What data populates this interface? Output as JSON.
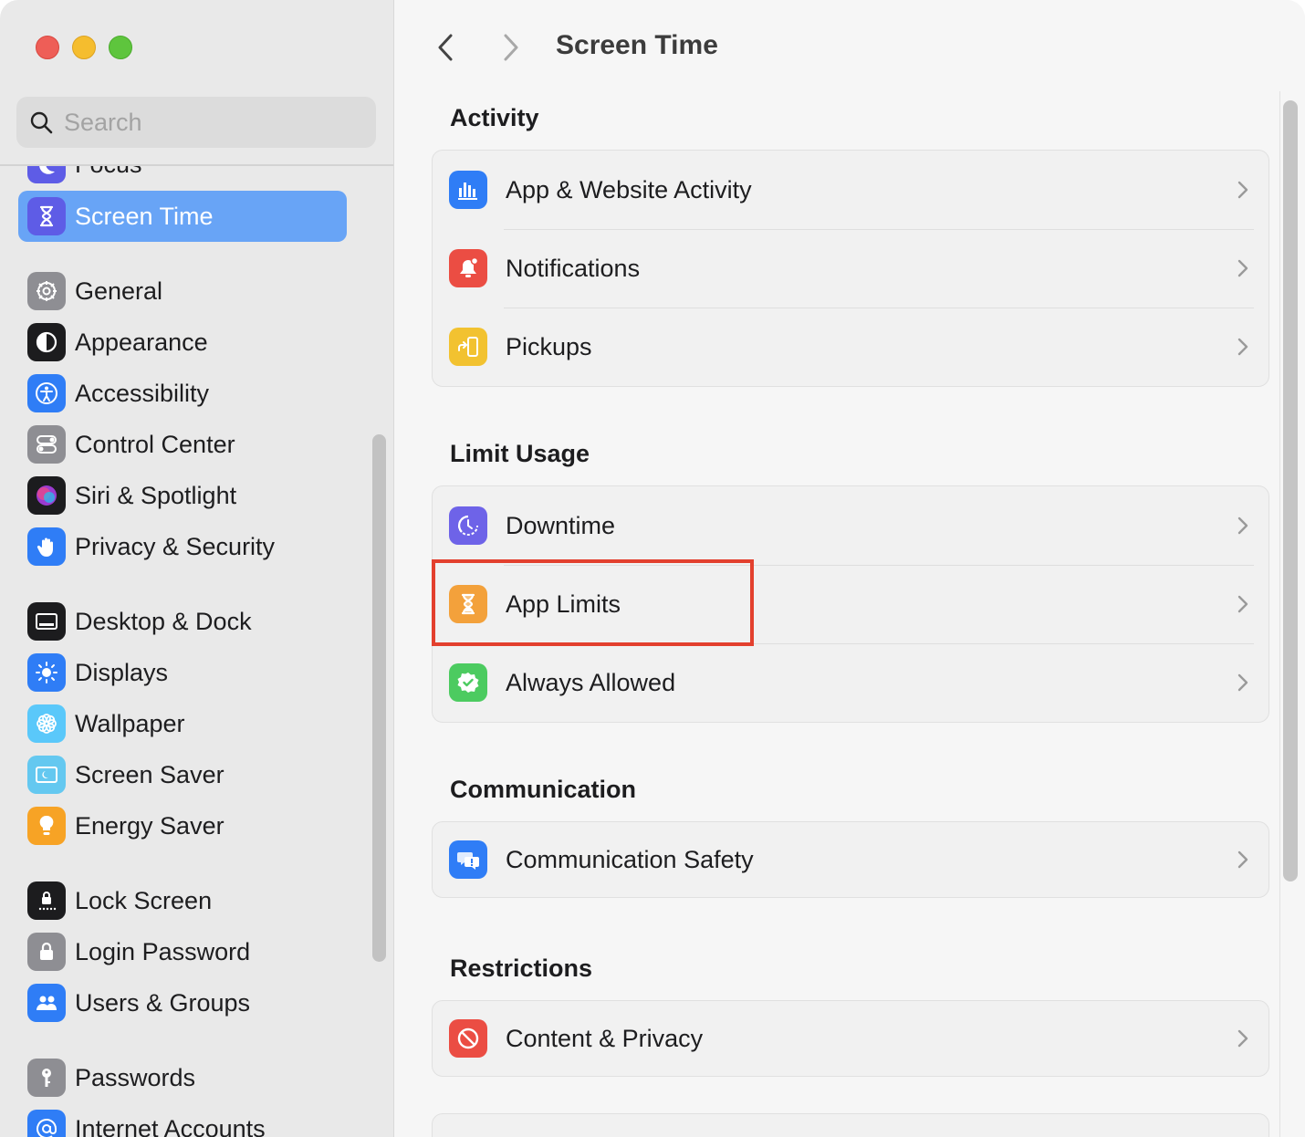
{
  "window": {
    "buttons": [
      "close",
      "minimize",
      "zoom"
    ]
  },
  "search": {
    "placeholder": "Search"
  },
  "sidebar": {
    "items": [
      {
        "label": "Focus",
        "icon": "moon-icon",
        "color": "#5e5ce6"
      },
      {
        "label": "Screen Time",
        "icon": "hourglass-icon",
        "color": "#5e5ce6",
        "active": true
      },
      {
        "label": "General",
        "icon": "gear-icon",
        "color": "#8e8e93"
      },
      {
        "label": "Appearance",
        "icon": "appearance-icon",
        "color": "#1c1c1e"
      },
      {
        "label": "Accessibility",
        "icon": "accessibility-icon",
        "color": "#2f7df6"
      },
      {
        "label": "Control Center",
        "icon": "toggles-icon",
        "color": "#8e8e93"
      },
      {
        "label": "Siri & Spotlight",
        "icon": "siri-icon",
        "color": "#1c1c1e"
      },
      {
        "label": "Privacy & Security",
        "icon": "hand-icon",
        "color": "#2f7df6"
      },
      {
        "label": "Desktop & Dock",
        "icon": "dock-icon",
        "color": "#1c1c1e"
      },
      {
        "label": "Displays",
        "icon": "sun-icon",
        "color": "#2f7df6"
      },
      {
        "label": "Wallpaper",
        "icon": "flower-icon",
        "color": "#5ac8fa"
      },
      {
        "label": "Screen Saver",
        "icon": "screensaver-icon",
        "color": "#64c8f0"
      },
      {
        "label": "Energy Saver",
        "icon": "bulb-icon",
        "color": "#f7a325"
      },
      {
        "label": "Lock Screen",
        "icon": "lock-screen-icon",
        "color": "#1c1c1e"
      },
      {
        "label": "Login Password",
        "icon": "lock-icon",
        "color": "#8e8e93"
      },
      {
        "label": "Users & Groups",
        "icon": "users-icon",
        "color": "#2f7df6"
      },
      {
        "label": "Passwords",
        "icon": "key-icon",
        "color": "#8e8e93"
      },
      {
        "label": "Internet Accounts",
        "icon": "at-icon",
        "color": "#2f7df6"
      }
    ]
  },
  "main": {
    "title": "Screen Time",
    "sections": [
      {
        "title": "Activity",
        "rows": [
          {
            "label": "App & Website Activity",
            "icon": "bar-chart-icon",
            "color": "#2f7df6"
          },
          {
            "label": "Notifications",
            "icon": "bell-icon",
            "color": "#eb4d43"
          },
          {
            "label": "Pickups",
            "icon": "pickup-icon",
            "color": "#f2c230"
          }
        ]
      },
      {
        "title": "Limit Usage",
        "rows": [
          {
            "label": "Downtime",
            "icon": "downtime-icon",
            "color": "#6e63e8"
          },
          {
            "label": "App Limits",
            "icon": "hourglass-icon",
            "color": "#f3a13b"
          },
          {
            "label": "Always Allowed",
            "icon": "checkmark-badge-icon",
            "color": "#4ccb60"
          }
        ]
      },
      {
        "title": "Communication",
        "rows": [
          {
            "label": "Communication Safety",
            "icon": "chat-bubble-icon",
            "color": "#2f7df6"
          }
        ]
      },
      {
        "title": "Restrictions",
        "rows": [
          {
            "label": "Content & Privacy",
            "icon": "no-symbol-icon",
            "color": "#eb4d43"
          }
        ]
      }
    ]
  }
}
